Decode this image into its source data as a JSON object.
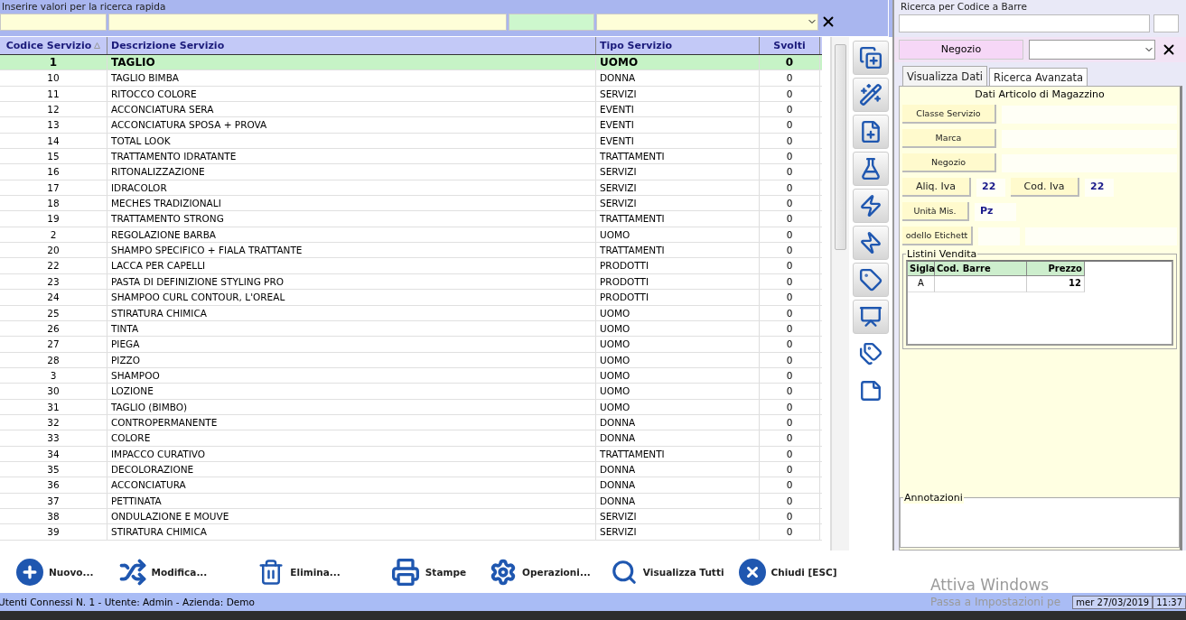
{
  "quick_search": {
    "legend": "Inserire valori per la ricerca rapida"
  },
  "table": {
    "columns": [
      {
        "label": "Codice Servizio",
        "sorted": true
      },
      {
        "label": "Descrizione Servizio",
        "sorted": false
      },
      {
        "label": "Tipo Servizio",
        "sorted": false
      },
      {
        "label": "Svolti",
        "sorted": false
      }
    ],
    "rows": [
      {
        "code": "1",
        "description": "TAGLIO",
        "type": "UOMO",
        "done": "0",
        "selected": true
      },
      {
        "code": "10",
        "description": "TAGLIO BIMBA",
        "type": "DONNA",
        "done": "0",
        "selected": false
      },
      {
        "code": "11",
        "description": "RITOCCO COLORE",
        "type": "SERVIZI",
        "done": "0",
        "selected": false
      },
      {
        "code": "12",
        "description": "ACCONCIATURA SERA",
        "type": "EVENTI",
        "done": "0",
        "selected": false
      },
      {
        "code": "13",
        "description": "ACCONCIATURA SPOSA + PROVA",
        "type": "EVENTI",
        "done": "0",
        "selected": false
      },
      {
        "code": "14",
        "description": "TOTAL LOOK",
        "type": "EVENTI",
        "done": "0",
        "selected": false
      },
      {
        "code": "15",
        "description": "TRATTAMENTO IDRATANTE",
        "type": "TRATTAMENTI",
        "done": "0",
        "selected": false
      },
      {
        "code": "16",
        "description": "RITONALIZZAZIONE",
        "type": "SERVIZI",
        "done": "0",
        "selected": false
      },
      {
        "code": "17",
        "description": "IDRACOLOR",
        "type": "SERVIZI",
        "done": "0",
        "selected": false
      },
      {
        "code": "18",
        "description": "MECHES TRADIZIONALI",
        "type": "SERVIZI",
        "done": "0",
        "selected": false
      },
      {
        "code": "19",
        "description": "TRATTAMENTO STRONG",
        "type": "TRATTAMENTI",
        "done": "0",
        "selected": false
      },
      {
        "code": "2",
        "description": "REGOLAZIONE BARBA",
        "type": "UOMO",
        "done": "0",
        "selected": false
      },
      {
        "code": "20",
        "description": "SHAMPO SPECIFICO + FIALA TRATTANTE",
        "type": "TRATTAMENTI",
        "done": "0",
        "selected": false
      },
      {
        "code": "22",
        "description": "LACCA PER CAPELLI",
        "type": "PRODOTTI",
        "done": "0",
        "selected": false
      },
      {
        "code": "23",
        "description": "PASTA DI DEFINIZIONE STYLING PRO",
        "type": "PRODOTTI",
        "done": "0",
        "selected": false
      },
      {
        "code": "24",
        "description": "SHAMPOO CURL CONTOUR, L'OREAL",
        "type": "PRODOTTI",
        "done": "0",
        "selected": false
      },
      {
        "code": "25",
        "description": "STIRATURA CHIMICA",
        "type": "UOMO",
        "done": "0",
        "selected": false
      },
      {
        "code": "26",
        "description": "TINTA",
        "type": "UOMO",
        "done": "0",
        "selected": false
      },
      {
        "code": "27",
        "description": "PIEGA",
        "type": "UOMO",
        "done": "0",
        "selected": false
      },
      {
        "code": "28",
        "description": "PIZZO",
        "type": "UOMO",
        "done": "0",
        "selected": false
      },
      {
        "code": "3",
        "description": "SHAMPOO",
        "type": "UOMO",
        "done": "0",
        "selected": false
      },
      {
        "code": "30",
        "description": "LOZIONE",
        "type": "UOMO",
        "done": "0",
        "selected": false
      },
      {
        "code": "31",
        "description": "TAGLIO (BIMBO)",
        "type": "UOMO",
        "done": "0",
        "selected": false
      },
      {
        "code": "32",
        "description": "CONTROPERMANENTE",
        "type": "DONNA",
        "done": "0",
        "selected": false
      },
      {
        "code": "33",
        "description": "COLORE",
        "type": "DONNA",
        "done": "0",
        "selected": false
      },
      {
        "code": "34",
        "description": "IMPACCO CURATIVO",
        "type": "TRATTAMENTI",
        "done": "0",
        "selected": false
      },
      {
        "code": "35",
        "description": "DECOLORAZIONE",
        "type": "DONNA",
        "done": "0",
        "selected": false
      },
      {
        "code": "36",
        "description": "ACCONCIATURA",
        "type": "DONNA",
        "done": "0",
        "selected": false
      },
      {
        "code": "37",
        "description": "PETTINATA",
        "type": "DONNA",
        "done": "0",
        "selected": false
      },
      {
        "code": "38",
        "description": "ONDULAZIONE E MOUVE",
        "type": "SERVIZI",
        "done": "0",
        "selected": false
      },
      {
        "code": "39",
        "description": "STIRATURA CHIMICA",
        "type": "SERVIZI",
        "done": "0",
        "selected": false
      }
    ]
  },
  "side_tools": [
    {
      "kind": "copy",
      "framed": true
    },
    {
      "kind": "wand",
      "framed": true
    },
    {
      "kind": "file",
      "framed": true
    },
    {
      "kind": "flask",
      "framed": true
    },
    {
      "kind": "bolt_up",
      "framed": true
    },
    {
      "kind": "bolt_down",
      "framed": true
    },
    {
      "kind": "tag",
      "framed": true
    },
    {
      "kind": "chart",
      "framed": true
    },
    {
      "kind": "tags",
      "framed": false
    },
    {
      "kind": "note",
      "framed": false
    }
  ],
  "barcode_search": {
    "legend": "Ricerca per Codice a Barre"
  },
  "shop_filter": {
    "label": "Negozio"
  },
  "tabs": [
    {
      "label": "Visualizza Dati",
      "selected": true
    },
    {
      "label": "Ricerca Avanzata",
      "selected": false
    }
  ],
  "details": {
    "title": "Dati Articolo di Magazzino",
    "fields": [
      {
        "label": "Classe Servizio"
      },
      {
        "label": "Marca"
      },
      {
        "label": "Negozio"
      }
    ],
    "aliq_iva": {
      "label": "Aliq. Iva",
      "value": "22"
    },
    "cod_iva": {
      "label": "Cod. Iva",
      "value": "22"
    },
    "unit": {
      "label": "Unità Mis.",
      "value": "Pz"
    },
    "label_model": {
      "label": "odello Etichett"
    },
    "price_lists": {
      "legend": "Listini Vendita",
      "columns": [
        "Sigla",
        "Cod. Barre",
        "Prezzo"
      ],
      "rows": [
        [
          "A",
          "",
          "12"
        ]
      ]
    },
    "notes": {
      "legend": "Annotazioni"
    }
  },
  "toolbar": [
    {
      "kind": "new",
      "label": "Nuovo..."
    },
    {
      "kind": "edit",
      "label": "Modifica..."
    },
    {
      "kind": "delete",
      "label": "Elimina..."
    },
    {
      "kind": "print",
      "label": "Stampe"
    },
    {
      "kind": "settings",
      "label": "Operazioni..."
    },
    {
      "kind": "search",
      "label": "Visualizza Tutti"
    },
    {
      "kind": "close",
      "label": "Chiudi [ESC]"
    }
  ],
  "activation_notice": {
    "title": "Attiva Windows",
    "text": "Passa a Impostazioni pe"
  },
  "status_bar": {
    "text": "Utenti Connessi N. 1 - Utente: Admin - Azienda: Demo",
    "date": "mer 27/03/2019",
    "time": "11:37"
  }
}
